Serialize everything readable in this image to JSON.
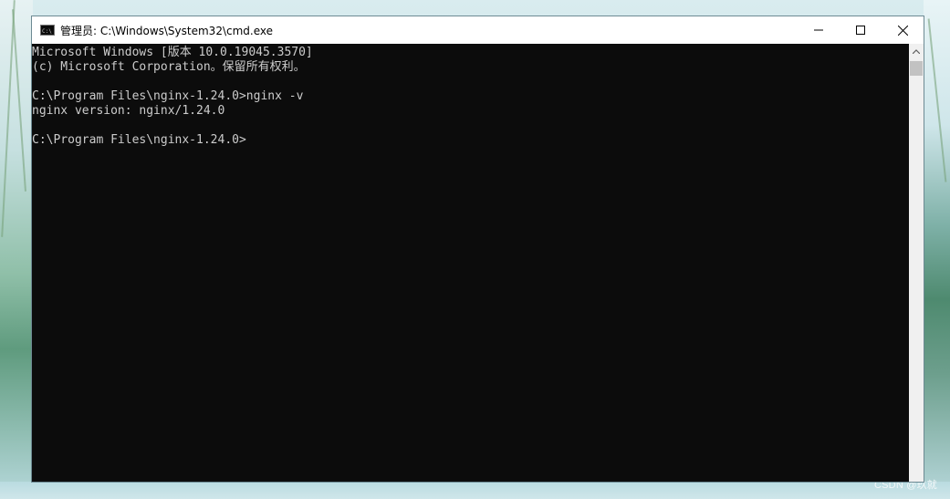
{
  "window": {
    "title": "管理员: C:\\Windows\\System32\\cmd.exe",
    "icon": "cmd-icon",
    "controls": {
      "minimize": "minimize-icon",
      "maximize": "maximize-icon",
      "close": "close-icon"
    }
  },
  "console": {
    "lines": [
      "Microsoft Windows [版本 10.0.19045.3570]",
      "(c) Microsoft Corporation。保留所有权利。",
      "",
      "C:\\Program Files\\nginx-1.24.0>nginx -v",
      "nginx version: nginx/1.24.0",
      "",
      "C:\\Program Files\\nginx-1.24.0>"
    ],
    "text_color": "#cccccc",
    "background_color": "#0c0c0c"
  },
  "desktop": {
    "watermark": "CSDN @玖就"
  }
}
